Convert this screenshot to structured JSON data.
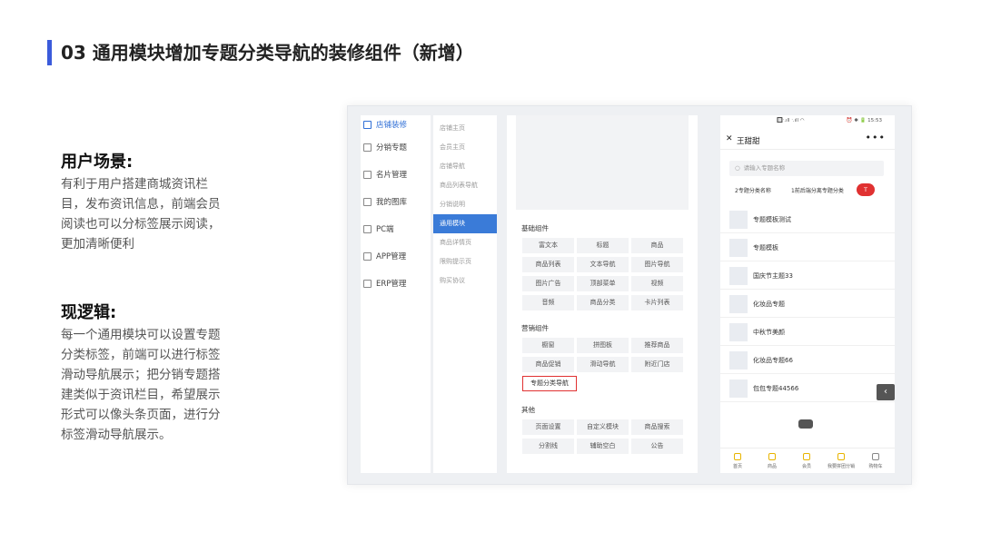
{
  "page": {
    "title": "03 通用模块增加专题分类导航的装修组件（新增）"
  },
  "scene": {
    "heading": "用户场景:",
    "body": "有利于用户搭建商城资讯栏目，发布资讯信息，前端会员阅读也可以分标签展示阅读，更加清晰便利"
  },
  "logic": {
    "heading": "现逻辑:",
    "body": "每一个通用模块可以设置专题分类标签，前端可以进行标签滑动导航展示；把分销专题搭建类似于资讯栏目，希望展示形式可以像头条页面，进行分标签滑动导航展示。"
  },
  "nav1": {
    "items": [
      {
        "label": "店铺装修",
        "icon": "brush-icon"
      },
      {
        "label": "分销专题",
        "icon": "image-icon"
      },
      {
        "label": "名片管理",
        "icon": "card-icon"
      },
      {
        "label": "我的图库",
        "icon": "gallery-icon"
      },
      {
        "label": "PC端",
        "icon": "monitor-icon"
      },
      {
        "label": "APP管理",
        "icon": "app-icon"
      },
      {
        "label": "ERP管理",
        "icon": "erp-icon"
      }
    ]
  },
  "nav2": {
    "items": [
      "店铺主页",
      "会员主页",
      "店铺导航",
      "商品列表导航",
      "分销说明",
      "通用模块",
      "商品详情页",
      "限购提示页",
      "购买协议"
    ]
  },
  "components": {
    "basic_title": "基础组件",
    "basic": [
      "富文本",
      "标题",
      "商品",
      "商品列表",
      "文本导航",
      "图片导航",
      "图片广告",
      "顶部菜单",
      "视频",
      "音频",
      "商品分类",
      "卡片列表"
    ],
    "marketing_title": "营销组件",
    "marketing": [
      "橱窗",
      "拼图板",
      "推荐商品",
      "商品促销",
      "滑动导航",
      "附近门店",
      "专题分类导航"
    ],
    "other_title": "其他",
    "other": [
      "页面设置",
      "自定义模块",
      "商品搜索",
      "分割线",
      "辅助空白",
      "公告"
    ]
  },
  "phone": {
    "status_left": "🔲ᐧ.ıll ᐧ.ıll ◠",
    "status_right": "⏰ ✱ 🔋 15:53",
    "close": "✕",
    "name": "王甜甜",
    "more": "•••",
    "search_placeholder": "请输入专题名称",
    "tab1": "2专题分类名称",
    "tab2": "1前后端分离专题分类",
    "tab_badge": "T",
    "rows": [
      "专题模板测试",
      "专题模板",
      "国庆节主题33",
      "化妆品专题",
      "中秋节美颜",
      "化妆品专题66",
      "包包专题44566"
    ],
    "tabbar": [
      "首页",
      "商品",
      "会员",
      "我要拼团分销",
      "购物车"
    ],
    "back": "‹"
  },
  "colors": {
    "accent_bar": "#3b5bdb",
    "active_blue": "#3a7bd8",
    "highlight_red": "#e03131"
  }
}
